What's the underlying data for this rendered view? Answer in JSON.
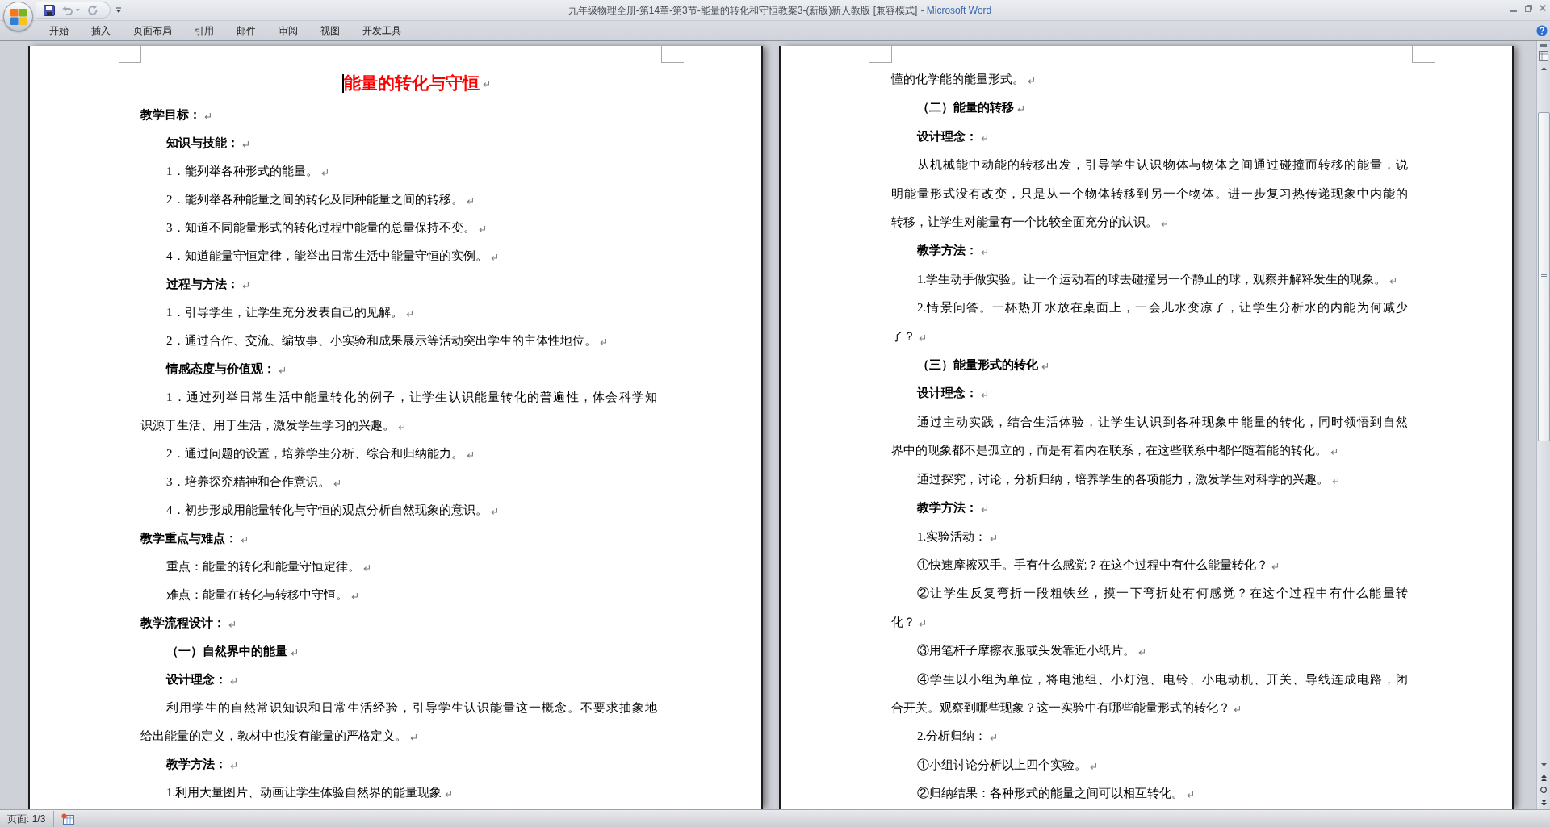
{
  "window": {
    "document_name": "九年级物理全册-第14章-第3节-能量的转化和守恒教案3-(新版)新人教版 [兼容模式]",
    "title_suffix": "- Microsoft Word"
  },
  "quick_access": [
    {
      "kind": "save",
      "disabled": false
    },
    {
      "kind": "undo",
      "disabled": true
    },
    {
      "kind": "redo",
      "disabled": true
    },
    {
      "kind": "customize",
      "disabled": false
    }
  ],
  "ribbon_tabs": [
    {
      "label": "开始",
      "selected": false
    },
    {
      "label": "插入",
      "selected": false
    },
    {
      "label": "页面布局",
      "selected": false
    },
    {
      "label": "引用",
      "selected": false
    },
    {
      "label": "邮件",
      "selected": false
    },
    {
      "label": "审阅",
      "selected": false
    },
    {
      "label": "视图",
      "selected": false
    },
    {
      "label": "开发工具",
      "selected": false
    }
  ],
  "show_paragraph_marks": true,
  "pages": [
    {
      "title": {
        "text": "能量的转化与守恒",
        "cursor": true
      },
      "paragraphs": [
        {
          "kind": "heading",
          "lines": [
            "教学目标："
          ]
        },
        {
          "kind": "subheading",
          "lines": [
            "知识与技能："
          ]
        },
        {
          "kind": "body",
          "lines": [
            "1．能列举各种形式的能量。"
          ]
        },
        {
          "kind": "body",
          "lines": [
            "2．能列举各种能量之间的转化及同种能量之间的转移。"
          ]
        },
        {
          "kind": "body",
          "lines": [
            "3．知道不同能量形式的转化过程中能量的总量保持不变。"
          ]
        },
        {
          "kind": "body",
          "lines": [
            "4．知道能量守恒定律，能举出日常生活中能量守恒的实例。"
          ]
        },
        {
          "kind": "subheading",
          "lines": [
            "过程与方法："
          ]
        },
        {
          "kind": "body",
          "lines": [
            "1．引导学生，让学生充分发表自己的见解。"
          ]
        },
        {
          "kind": "body",
          "lines": [
            "2．通过合作、交流、编故事、小实验和成果展示等活动突出学生的主体性地位。"
          ]
        },
        {
          "kind": "subheading",
          "lines": [
            "情感态度与价值观："
          ]
        },
        {
          "kind": "body",
          "lines": [
            "1．通过列举日常生活中能量转化的例子，让学生认识能量转化的普遍性，体会科学知",
            "识源于生活、用于生活，激发学生学习的兴趣。"
          ]
        },
        {
          "kind": "body",
          "lines": [
            "2．通过问题的设置，培养学生分析、综合和归纳能力。"
          ]
        },
        {
          "kind": "body",
          "lines": [
            "3．培养探究精神和合作意识。"
          ]
        },
        {
          "kind": "body",
          "lines": [
            "4．初步形成用能量转化与守恒的观点分析自然现象的意识。"
          ]
        },
        {
          "kind": "heading",
          "lines": [
            "教学重点与难点："
          ]
        },
        {
          "kind": "body",
          "lines": [
            "重点：能量的转化和能量守恒定律。"
          ]
        },
        {
          "kind": "body",
          "lines": [
            "难点：能量在转化与转移中守恒。"
          ]
        },
        {
          "kind": "heading",
          "lines": [
            "教学流程设计："
          ]
        },
        {
          "kind": "subheading",
          "lines": [
            "（一）自然界中的能量"
          ]
        },
        {
          "kind": "subheading",
          "lines": [
            "设计理念："
          ]
        },
        {
          "kind": "body",
          "lines": [
            "利用学生的自然常识知识和日常生活经验，引导学生认识能量这一概念。不要求抽象地",
            "给出能量的定义，教材中也没有能量的严格定义。"
          ]
        },
        {
          "kind": "subheading",
          "lines": [
            "教学方法："
          ]
        },
        {
          "kind": "body",
          "lines": [
            "1.利用大量图片、动画让学生体验自然界的能量现象"
          ]
        }
      ]
    },
    {
      "paragraphs": [
        {
          "kind": "continued",
          "lines": [
            "懂的化学能的能量形式。"
          ]
        },
        {
          "kind": "subheading",
          "lines": [
            "（二）能量的转移"
          ]
        },
        {
          "kind": "subheading",
          "lines": [
            "设计理念："
          ]
        },
        {
          "kind": "body",
          "lines": [
            "从机械能中动能的转移出发，引导学生认识物体与物体之间通过碰撞而转移的能量，说",
            "明能量形式没有改变，只是从一个物体转移到另一个物体。进一步复习热传递现象中内能的",
            "转移，让学生对能量有一个比较全面充分的认识。"
          ]
        },
        {
          "kind": "subheading",
          "lines": [
            "教学方法："
          ]
        },
        {
          "kind": "body",
          "lines": [
            "1.学生动手做实验。让一个运动着的球去碰撞另一个静止的球，观察并解释发生的现象。"
          ]
        },
        {
          "kind": "body",
          "lines": [
            "2.情景问答。一杯热开水放在桌面上，一会儿水变凉了，让学生分析水的内能为何减少",
            "了？"
          ]
        },
        {
          "kind": "subheading",
          "lines": [
            "（三）能量形式的转化"
          ]
        },
        {
          "kind": "subheading",
          "lines": [
            "设计理念："
          ]
        },
        {
          "kind": "body",
          "lines": [
            "通过主动实践，结合生活体验，让学生认识到各种现象中能量的转化，同时领悟到自然",
            "界中的现象都不是孤立的，而是有着内在联系，在这些联系中都伴随着能的转化。"
          ]
        },
        {
          "kind": "body",
          "lines": [
            "通过探究，讨论，分析归纳，培养学生的各项能力，激发学生对科学的兴趣。"
          ]
        },
        {
          "kind": "subheading",
          "lines": [
            "教学方法："
          ]
        },
        {
          "kind": "body",
          "lines": [
            "1.实验活动："
          ]
        },
        {
          "kind": "body",
          "lines": [
            "①快速摩擦双手。手有什么感觉？在这个过程中有什么能量转化？"
          ]
        },
        {
          "kind": "body",
          "lines": [
            "②让学生反复弯折一段粗铁丝，摸一下弯折处有何感觉？在这个过程中有什么能量转",
            "化？"
          ]
        },
        {
          "kind": "body",
          "lines": [
            "③用笔杆子摩擦衣服或头发靠近小纸片。"
          ]
        },
        {
          "kind": "body",
          "lines": [
            "④学生以小组为单位，将电池组、小灯泡、电铃、小电动机、开关、导线连成电路，闭",
            "合开关。观察到哪些现象？这一实验中有哪些能量形式的转化？"
          ]
        },
        {
          "kind": "body",
          "lines": [
            "2.分析归纳："
          ]
        },
        {
          "kind": "body",
          "lines": [
            "①小组讨论分析以上四个实验。"
          ]
        },
        {
          "kind": "body",
          "lines": [
            "②归纳结果：各种形式的能量之间可以相互转化。"
          ]
        }
      ]
    }
  ],
  "status_bar": {
    "page": "页面: 1/3"
  }
}
